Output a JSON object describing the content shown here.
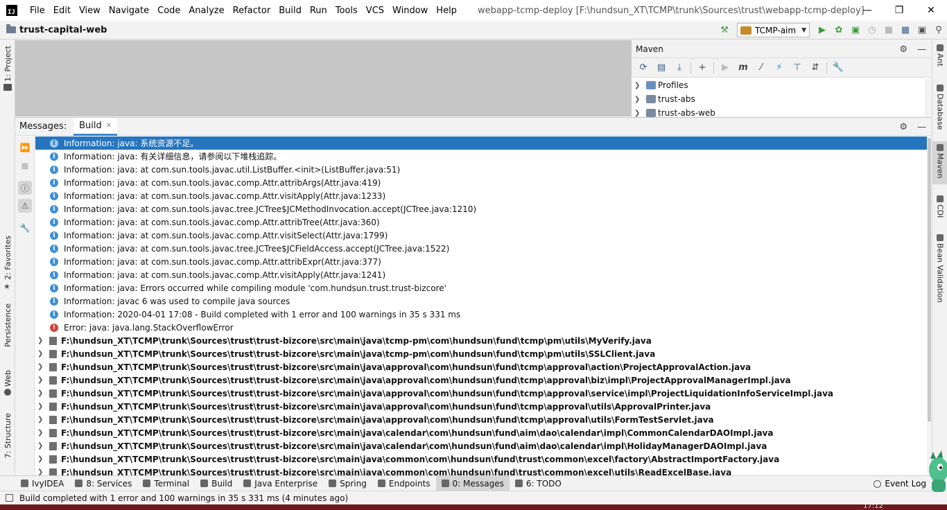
{
  "app": {
    "logo_text": "IJ",
    "window_title": "webapp-tcmp-deploy [F:\\hundsun_XT\\TCMP\\trunk\\Sources\\trust\\webapp-tcmp-deploy]"
  },
  "menu": [
    "File",
    "Edit",
    "View",
    "Navigate",
    "Code",
    "Analyze",
    "Refactor",
    "Build",
    "Run",
    "Tools",
    "VCS",
    "Window",
    "Help"
  ],
  "navbar": {
    "project": "trust-capital-web",
    "run_config": "TCMP-aim"
  },
  "left_tabs": [
    {
      "label": "1: Project"
    },
    {
      "label": "2: Favorites"
    },
    {
      "label": "Persistence"
    },
    {
      "label": "Web"
    },
    {
      "label": "7: Structure"
    }
  ],
  "right_tabs": [
    {
      "label": "Ant"
    },
    {
      "label": "Database"
    },
    {
      "label": "Maven"
    },
    {
      "label": "CDI"
    },
    {
      "label": "Bean Validation"
    }
  ],
  "maven": {
    "title": "Maven",
    "items": [
      {
        "label": "Profiles"
      },
      {
        "label": "trust-abs"
      },
      {
        "label": "trust-abs-web"
      }
    ]
  },
  "messages": {
    "title": "Messages:",
    "tab": "Build",
    "entries": [
      {
        "kind": "info",
        "text": "Information: java: 系统资源不足。"
      },
      {
        "kind": "info",
        "text": "Information: java: 有关详细信息，请参阅以下堆栈追踪。"
      },
      {
        "kind": "info",
        "text": "Information: java: at com.sun.tools.javac.util.ListBuffer.<init>(ListBuffer.java:51)"
      },
      {
        "kind": "info",
        "text": "Information: java: at com.sun.tools.javac.comp.Attr.attribArgs(Attr.java:419)"
      },
      {
        "kind": "info",
        "text": "Information: java: at com.sun.tools.javac.comp.Attr.visitApply(Attr.java:1233)"
      },
      {
        "kind": "info",
        "text": "Information: java: at com.sun.tools.javac.tree.JCTree$JCMethodInvocation.accept(JCTree.java:1210)"
      },
      {
        "kind": "info",
        "text": "Information: java: at com.sun.tools.javac.comp.Attr.attribTree(Attr.java:360)"
      },
      {
        "kind": "info",
        "text": "Information: java: at com.sun.tools.javac.comp.Attr.visitSelect(Attr.java:1799)"
      },
      {
        "kind": "info",
        "text": "Information: java: at com.sun.tools.javac.tree.JCTree$JCFieldAccess.accept(JCTree.java:1522)"
      },
      {
        "kind": "info",
        "text": "Information: java: at com.sun.tools.javac.comp.Attr.attribExpr(Attr.java:377)"
      },
      {
        "kind": "info",
        "text": "Information: java: at com.sun.tools.javac.comp.Attr.visitApply(Attr.java:1241)"
      },
      {
        "kind": "info",
        "text": "Information: java: Errors occurred while compiling module 'com.hundsun.trust.trust-bizcore'"
      },
      {
        "kind": "info",
        "text": "Information: javac 6 was used to compile java sources"
      },
      {
        "kind": "info",
        "text": "Information: 2020-04-01 17:08 - Build completed with 1 error and 100 warnings in 35 s 331 ms"
      },
      {
        "kind": "error",
        "text": "Error: java: java.lang.StackOverflowError"
      }
    ],
    "files": [
      "F:\\hundsun_XT\\TCMP\\trunk\\Sources\\trust\\trust-bizcore\\src\\main\\java\\tcmp-pm\\com\\hundsun\\fund\\tcmp\\pm\\utils\\MyVerify.java",
      "F:\\hundsun_XT\\TCMP\\trunk\\Sources\\trust\\trust-bizcore\\src\\main\\java\\tcmp-pm\\com\\hundsun\\fund\\tcmp\\pm\\utils\\SSLClient.java",
      "F:\\hundsun_XT\\TCMP\\trunk\\Sources\\trust\\trust-bizcore\\src\\main\\java\\approval\\com\\hundsun\\fund\\tcmp\\approval\\action\\ProjectApprovalAction.java",
      "F:\\hundsun_XT\\TCMP\\trunk\\Sources\\trust\\trust-bizcore\\src\\main\\java\\approval\\com\\hundsun\\fund\\tcmp\\approval\\biz\\impl\\ProjectApprovalManagerImpl.java",
      "F:\\hundsun_XT\\TCMP\\trunk\\Sources\\trust\\trust-bizcore\\src\\main\\java\\approval\\com\\hundsun\\fund\\tcmp\\approval\\service\\impl\\ProjectLiquidationInfoServiceImpl.java",
      "F:\\hundsun_XT\\TCMP\\trunk\\Sources\\trust\\trust-bizcore\\src\\main\\java\\approval\\com\\hundsun\\fund\\tcmp\\approval\\utils\\ApprovalPrinter.java",
      "F:\\hundsun_XT\\TCMP\\trunk\\Sources\\trust\\trust-bizcore\\src\\main\\java\\approval\\com\\hundsun\\fund\\tcmp\\approval\\utils\\FormTestServlet.java",
      "F:\\hundsun_XT\\TCMP\\trunk\\Sources\\trust\\trust-bizcore\\src\\main\\java\\calendar\\com\\hundsun\\fund\\aim\\dao\\calendar\\impl\\CommonCalendarDAOImpl.java",
      "F:\\hundsun_XT\\TCMP\\trunk\\Sources\\trust\\trust-bizcore\\src\\main\\java\\calendar\\com\\hundsun\\fund\\aim\\dao\\calendar\\impl\\HolidayManagerDAOImpl.java",
      "F:\\hundsun_XT\\TCMP\\trunk\\Sources\\trust\\trust-bizcore\\src\\main\\java\\common\\com\\hundsun\\fund\\trust\\common\\excel\\factory\\AbstractImportFactory.java",
      "F:\\hundsun_XT\\TCMP\\trunk\\Sources\\trust\\trust-bizcore\\src\\main\\java\\common\\com\\hundsun\\fund\\trust\\common\\excel\\utils\\ReadExcelBase.java"
    ]
  },
  "bottom_tabs": [
    {
      "label": "IvyIDEA",
      "icon": "ivy-icon"
    },
    {
      "label": "8: Services",
      "icon": "services-icon"
    },
    {
      "label": "Terminal",
      "icon": "terminal-icon"
    },
    {
      "label": "Build",
      "icon": "hammer-icon"
    },
    {
      "label": "Java Enterprise",
      "icon": "java-enterprise-icon"
    },
    {
      "label": "Spring",
      "icon": "spring-icon"
    },
    {
      "label": "Endpoints",
      "icon": "endpoints-icon"
    },
    {
      "label": "0: Messages",
      "icon": "messages-icon",
      "active": true
    },
    {
      "label": "6: TODO",
      "icon": "todo-icon"
    }
  ],
  "event_log": "Event Log",
  "status": {
    "text": "Build completed with 1 error and 100 warnings in 35 s 331 ms (4 minutes ago)"
  },
  "taskbar": {
    "clock": "17:12"
  },
  "colors": {
    "selection": "#2675bf",
    "info_icon": "#3d8fd4",
    "error_icon": "#d9403a",
    "run_green": "#3a9d3a"
  }
}
